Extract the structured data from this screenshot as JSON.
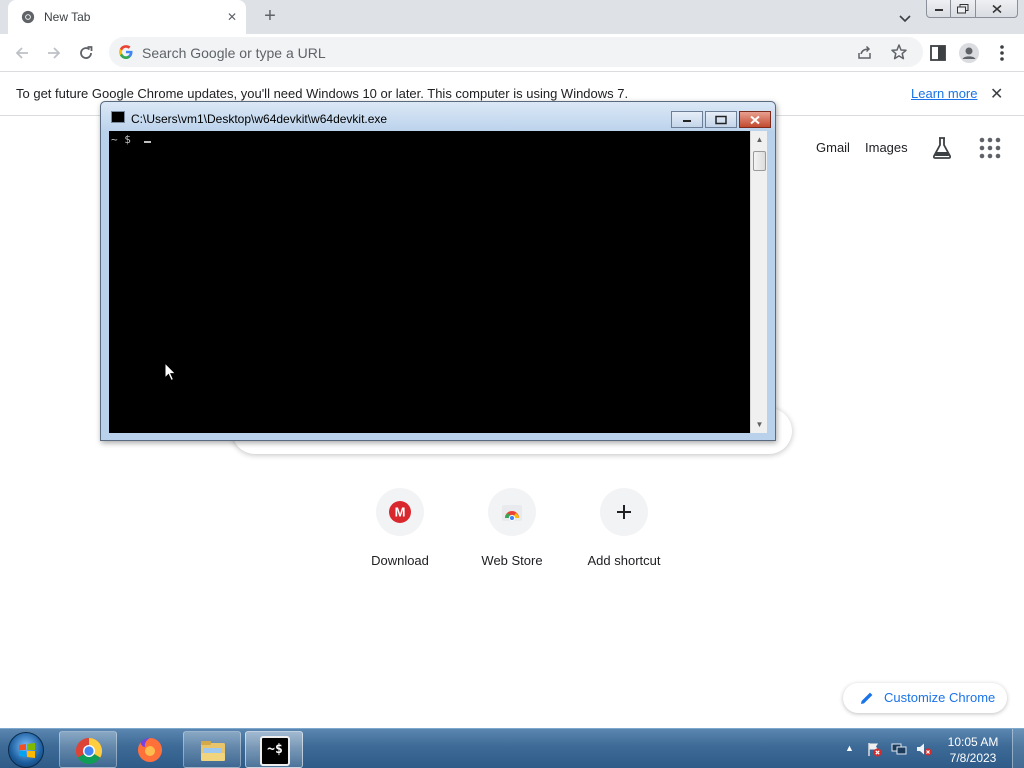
{
  "browser": {
    "tab": {
      "title": "New Tab",
      "favicon": "chrome-icon",
      "close_glyph": "✕"
    },
    "new_tab_glyph": "+",
    "omnibox": {
      "placeholder": "Search Google or type a URL"
    },
    "toolbar_icons": [
      "back-arrow-icon",
      "forward-arrow-icon",
      "reload-icon",
      "share-icon",
      "bookmark-star-icon",
      "side-panel-icon",
      "profile-avatar-icon",
      "more-menu-icon"
    ]
  },
  "infobar": {
    "message": "To get future Google Chrome updates, you'll need Windows 10 or later. This computer is using Windows 7.",
    "link": "Learn more",
    "close_glyph": "✕"
  },
  "ntp": {
    "header_links": [
      "Gmail",
      "Images"
    ],
    "shortcuts": [
      {
        "label": "Download",
        "icon": "mega-icon",
        "color": "#d9272e",
        "glyph": "M"
      },
      {
        "label": "Web Store",
        "icon": "web-store-icon",
        "glyph": ""
      },
      {
        "label": "Add shortcut",
        "icon": "plus-icon",
        "glyph": "+"
      }
    ],
    "customize_label": "Customize Chrome"
  },
  "console": {
    "title": "C:\\Users\\vm1\\Desktop\\w64devkit\\w64devkit.exe",
    "prompt": "~ $",
    "scroll_up_glyph": "▲",
    "scroll_down_glyph": "▼"
  },
  "taskbar": {
    "apps": [
      "chrome-icon",
      "firefox-icon",
      "file-explorer-icon",
      "w64devkit-icon"
    ],
    "console_icon_text": "~$",
    "tray_arrow": "▲",
    "tray_icons": [
      "action-center-flag-icon",
      "network-icon",
      "volume-muted-icon"
    ],
    "clock": {
      "time": "10:05 AM",
      "date": "7/8/2023"
    }
  },
  "colors": {
    "tabstrip_bg": "#dee1e6",
    "link_blue": "#1a73e8",
    "taskbar_blue": "#3d6a96",
    "console_frame": "#b9d1ea"
  }
}
